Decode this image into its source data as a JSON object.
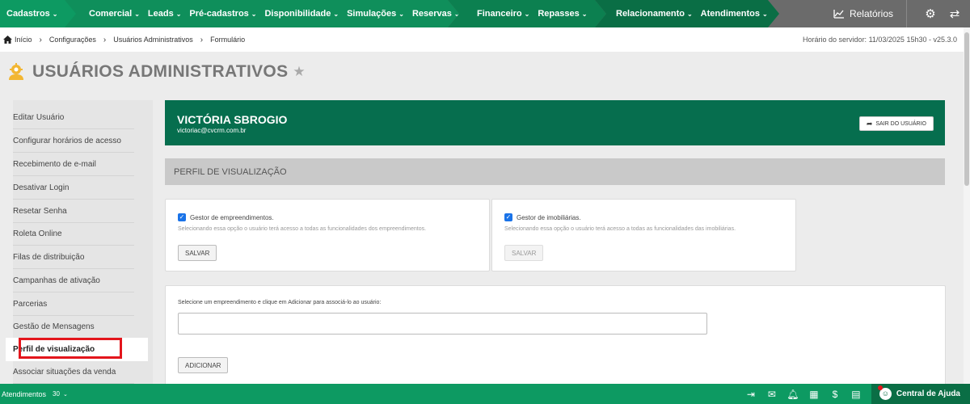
{
  "topnav": {
    "cadastros": "Cadastros",
    "group2": [
      "Comercial",
      "Leads",
      "Pré-cadastros",
      "Disponibilidade",
      "Simulações",
      "Reservas"
    ],
    "group3": [
      "Financeiro",
      "Repasses"
    ],
    "group4": [
      "Relacionamento",
      "Atendimentos"
    ],
    "reports": "Relatórios"
  },
  "breadcrumb": {
    "items": [
      "Início",
      "Configurações",
      "Usuários Administrativos",
      "Formulário"
    ],
    "server_time": "Horário do servidor: 11/03/2025 15h30 - v25.3.0"
  },
  "page": {
    "title": "USUÁRIOS ADMINISTRATIVOS"
  },
  "sidebar": {
    "items": [
      "Editar Usuário",
      "Configurar horários de acesso",
      "Recebimento de e-mail",
      "Desativar Login",
      "Resetar Senha",
      "Roleta Online",
      "Filas de distribuição",
      "Campanhas de ativação",
      "Parcerias",
      "Gestão de Mensagens",
      "Perfil de visualização",
      "Associar situações da venda"
    ],
    "active_index": 10
  },
  "user": {
    "name": "VICTÓRIA SBROGIO",
    "email": "victoriac@cvcrm.com.br",
    "exit_label": "SAIR DO USUÁRIO"
  },
  "section": {
    "title": "PERFIL DE VISUALIZAÇÃO"
  },
  "cards": [
    {
      "label": "Gestor de empreendimentos.",
      "checked": true,
      "helper": "Selecionando essa opção o usuário terá acesso a todas as funcionalidades dos empreendimentos.",
      "button": "SALVAR",
      "button_enabled": true
    },
    {
      "label": "Gestor de imobiliárias.",
      "checked": true,
      "helper": "Selecionando essa opção o usuário terá acesso a todas as funcionalidades das imobiliárias.",
      "button": "SALVAR",
      "button_enabled": false
    }
  ],
  "association": {
    "label": "Selecione um empreendimento e clique em Adicionar para associá-lo ao usuário:",
    "value": "",
    "add_button": "ADICIONAR"
  },
  "bottombar": {
    "label": "Atendimentos",
    "count": "30",
    "help": "Central de Ajuda"
  },
  "colors": {
    "brand_green": "#0d9a62",
    "banner_green": "#066e4e",
    "highlight_red": "#e3151c"
  }
}
